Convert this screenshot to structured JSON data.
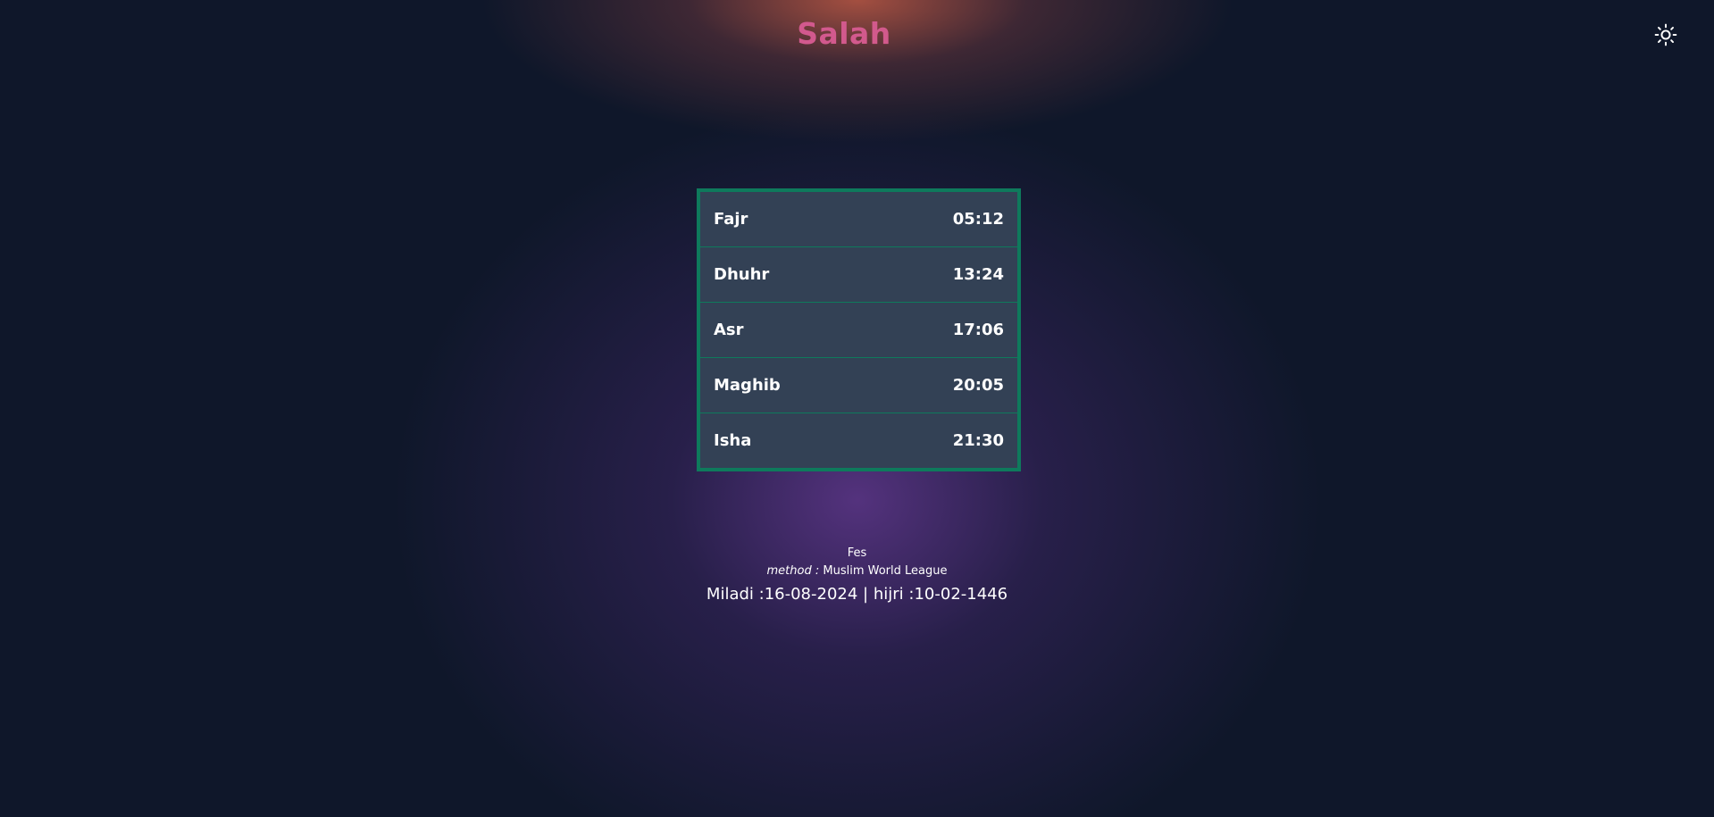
{
  "app": {
    "title": "Salah",
    "theme_toggle_icon": "sun-icon"
  },
  "prayers": [
    {
      "name": "Fajr",
      "time": "05:12"
    },
    {
      "name": "Dhuhr",
      "time": "13:24"
    },
    {
      "name": "Asr",
      "time": "17:06"
    },
    {
      "name": "Maghib",
      "time": "20:05"
    },
    {
      "name": "Isha",
      "time": "21:30"
    }
  ],
  "info": {
    "city": "Fes",
    "method_label": "method :",
    "method_value": "Muslim World League",
    "miladi_label": "Miladi :",
    "miladi_date": "16-08-2024",
    "separator": "|",
    "hijri_label": "hijri :",
    "hijri_date": "10-02-1446"
  },
  "colors": {
    "background": "#0f172a",
    "table_bg": "#334155",
    "table_border": "#0e7a5c",
    "title_gradient_start": "#c8569c",
    "title_gradient_end": "#cc6a70"
  }
}
